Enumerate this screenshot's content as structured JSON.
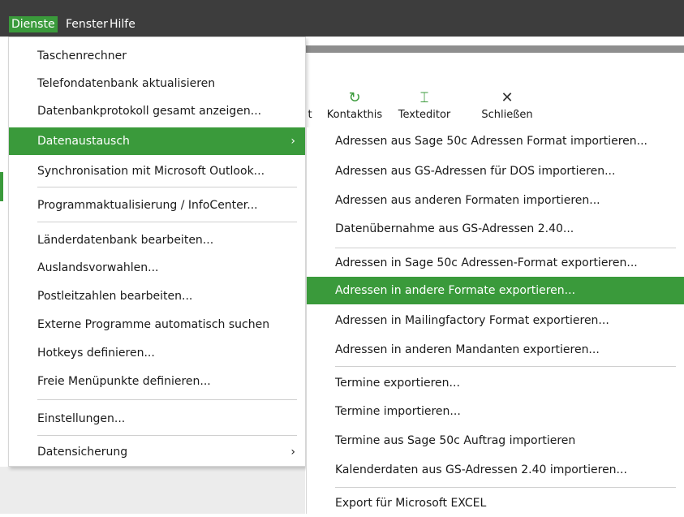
{
  "menubar": {
    "items": [
      {
        "label": "Dienste"
      },
      {
        "label": "Fenster"
      },
      {
        "label": "Hilfe"
      }
    ]
  },
  "toolbar": {
    "partial_label": "t",
    "kontakthist_label": "Kontakthis",
    "texteditor_label": "Texteditor",
    "close_label": "Schließen",
    "close_glyph": "✕",
    "history_glyph": "↻",
    "editor_glyph": "⌶"
  },
  "dienste_menu": {
    "items": [
      {
        "label": "Taschenrechner"
      },
      {
        "label": "Telefondatenbank aktualisieren"
      },
      {
        "label": "Datenbankprotokoll gesamt anzeigen..."
      },
      {
        "label": "Datenaustausch",
        "arrow": "›"
      },
      {
        "label": "Synchronisation mit Microsoft Outlook..."
      },
      {
        "label": "Programmaktualisierung / InfoCenter..."
      },
      {
        "label": "Länderdatenbank bearbeiten..."
      },
      {
        "label": "Auslandsvorwahlen..."
      },
      {
        "label": "Postleitzahlen bearbeiten..."
      },
      {
        "label": "Externe Programme automatisch suchen"
      },
      {
        "label": "Hotkeys definieren..."
      },
      {
        "label": "Freie Menüpunkte definieren..."
      },
      {
        "label": "Einstellungen..."
      },
      {
        "label": "Datensicherung",
        "arrow": "›"
      }
    ]
  },
  "datenaustausch_submenu": {
    "items": [
      {
        "label": "Adressen aus Sage 50c Adressen Format importieren..."
      },
      {
        "label": "Adressen aus GS-Adressen für DOS importieren..."
      },
      {
        "label": "Adressen aus anderen Formaten importieren..."
      },
      {
        "label": "Datenübernahme aus GS-Adressen 2.40..."
      },
      {
        "label": "Adressen in Sage 50c Adressen-Format exportieren..."
      },
      {
        "label": "Adressen in andere Formate exportieren..."
      },
      {
        "label": "Adressen in Mailingfactory Format exportieren..."
      },
      {
        "label": "Adressen in anderen Mandanten exportieren..."
      },
      {
        "label": "Termine exportieren..."
      },
      {
        "label": "Termine importieren..."
      },
      {
        "label": "Termine aus Sage 50c Auftrag importieren"
      },
      {
        "label": "Kalenderdaten aus GS-Adressen 2.40 importieren..."
      },
      {
        "label": "Export für Microsoft EXCEL"
      }
    ]
  },
  "colors": {
    "accent": "#3a9a3b",
    "menubar_bg": "#3d3d3d"
  }
}
